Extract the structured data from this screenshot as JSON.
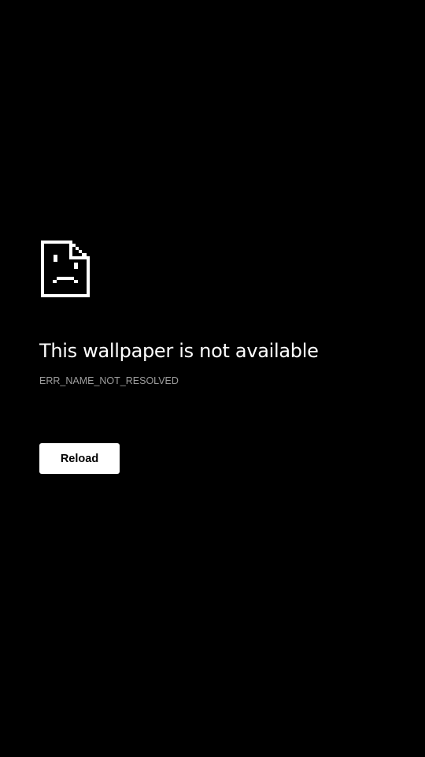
{
  "error": {
    "icon": "sad-page-icon",
    "title": "This wallpaper is not available",
    "code": "ERR_NAME_NOT_RESOLVED"
  },
  "actions": {
    "reload_label": "Reload"
  },
  "colors": {
    "background": "#000000",
    "title": "#ffffff",
    "code": "#9e9e9e",
    "button_bg": "#ffffff",
    "button_text": "#000000"
  }
}
